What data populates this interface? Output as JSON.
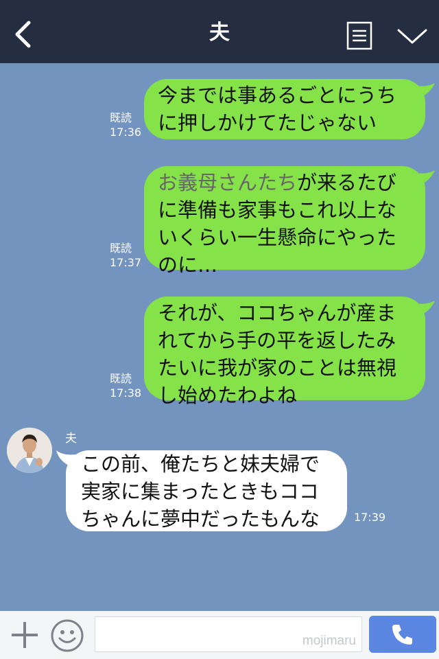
{
  "header": {
    "title": "夫",
    "back_icon": "chevron-left-icon",
    "menu_icon": "note-icon",
    "dropdown_icon": "chevron-down-icon"
  },
  "messages": [
    {
      "direction": "outgoing",
      "lines": [
        "今までは事あるごとにうち",
        "に押しかけてたじゃない"
      ],
      "read": "既読",
      "time": "17:36"
    },
    {
      "direction": "outgoing",
      "lines_first_rich": [
        {
          "text": "お義母さんたち",
          "color": "#666666"
        },
        {
          "text": "が来るたび",
          "color": "#111111"
        }
      ],
      "lines": [
        "に準備も家事もこれ以上な",
        "いくらい一生懸命にやった",
        "のに…"
      ],
      "read": "既読",
      "time": "17:37"
    },
    {
      "direction": "outgoing",
      "lines": [
        "それが、ココちゃんが産ま",
        "れてから手の平を返したみ",
        "たいに我が家のことは無視",
        "し始めたわよね"
      ],
      "read": "既読",
      "time": "17:38"
    },
    {
      "direction": "incoming",
      "sender": "夫",
      "lines": [
        "この前、俺たちと妹夫婦で",
        "実家に集まったときもココ",
        "ちゃんに夢中だったもんな"
      ],
      "time": "17:39"
    }
  ],
  "footer": {
    "watermark": "mojimaru",
    "input_value": ""
  },
  "colors": {
    "background": "#7494c0",
    "header": "#252d40",
    "outgoing_bubble": "#85e249",
    "incoming_bubble": "#ffffff",
    "call_button": "#5b86e2"
  }
}
